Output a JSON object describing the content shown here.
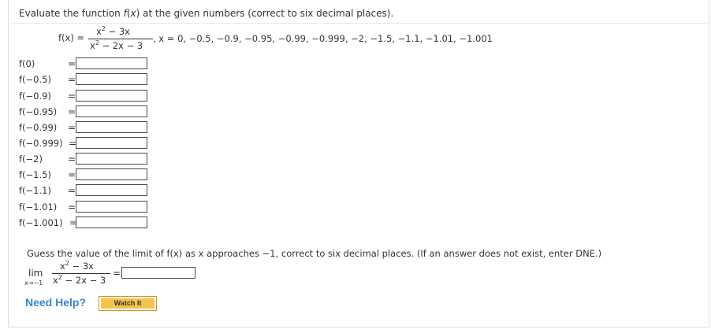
{
  "question": {
    "instruction_parts": [
      "Evaluate the function ",
      "f",
      "(",
      "x",
      ") at the given numbers (correct to six decimal places)."
    ],
    "function": {
      "name": "f(x)",
      "equals": "=",
      "numerator": "x",
      "numerator_exp": "2",
      "numerator_rest": " − 3x",
      "denominator": "x",
      "denominator_exp": "2",
      "denominator_rest": " − 2x − 3",
      "domain_note": ",  x = 0, −0.5, −0.9, −0.95, −0.99, −0.999, −2, −1.5, −1.1, −1.01, −1.001"
    },
    "rows": [
      {
        "label": "f(0)",
        "value": ""
      },
      {
        "label": "f(−0.5)",
        "value": ""
      },
      {
        "label": "f(−0.9)",
        "value": ""
      },
      {
        "label": "f(−0.95)",
        "value": ""
      },
      {
        "label": "f(−0.99)",
        "value": ""
      },
      {
        "label": "f(−0.999)",
        "value": ""
      },
      {
        "label": "f(−2)",
        "value": ""
      },
      {
        "label": "f(−1.5)",
        "value": ""
      },
      {
        "label": "f(−1.1)",
        "value": ""
      },
      {
        "label": "f(−1.01)",
        "value": ""
      },
      {
        "label": "f(−1.001)",
        "value": ""
      }
    ],
    "row_equals": "="
  },
  "limit": {
    "prompt": "Guess the value of the limit of f(x) as x approaches −1, correct to six decimal places. (If an answer does not exist, enter DNE.)",
    "lim": "lim",
    "sub": "x→−1",
    "numerator": "x",
    "numerator_exp": "2",
    "numerator_rest": " − 3x",
    "denominator": "x",
    "denominator_exp": "2",
    "denominator_rest": " − 2x − 3",
    "equals": "=",
    "value": ""
  },
  "help": {
    "label": "Need Help?",
    "watch_button": "Watch It"
  },
  "colors": {
    "help_link": "#3a87c8",
    "watch_button": "#f4c44a",
    "variable_red": "#cc2222"
  }
}
